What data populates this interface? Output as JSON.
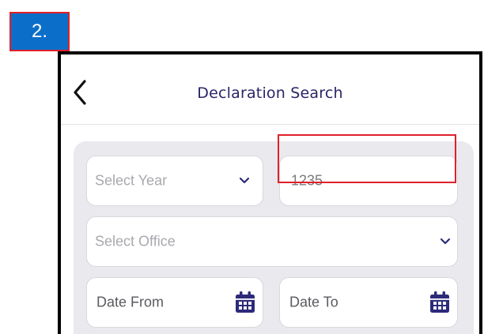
{
  "step_badge": {
    "label": "2."
  },
  "header": {
    "title": "Declaration Search",
    "back_icon": "chevron-left-icon"
  },
  "form": {
    "year_select": {
      "placeholder": "Select Year",
      "icon": "chevron-down-icon"
    },
    "number_input": {
      "value": "1235"
    },
    "office_select": {
      "placeholder": "Select Office",
      "icon": "chevron-down-icon"
    },
    "date_from": {
      "label": "Date From",
      "icon": "calendar-icon"
    },
    "date_to": {
      "label": "Date To",
      "icon": "calendar-icon"
    }
  },
  "colors": {
    "badge_bg": "#0b6fc9",
    "highlight": "#e0202a",
    "title": "#2a2468",
    "accent_icon": "#2d2a7a",
    "panel_bg": "#e9e9ee"
  }
}
